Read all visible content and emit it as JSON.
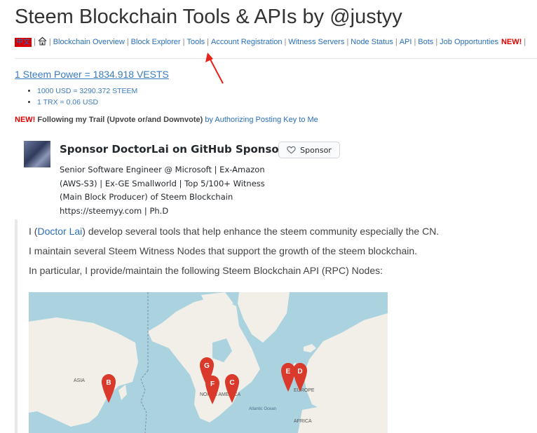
{
  "page": {
    "title": "Steem Blockchain Tools & APIs by @justyy"
  },
  "nav": {
    "lang_badge": "中文",
    "items": [
      "Blockchain Overview",
      "Block Explorer",
      "Tools",
      "Account Registration",
      "Witness Servers",
      "Node Status",
      "API",
      "Bots",
      "Job Opportunties"
    ],
    "new_label": "NEW!"
  },
  "rates": {
    "steem_power": "1 Steem Power = 1834.918 VESTS",
    "usd": "1000 USD = 3290.372 STEEM",
    "trx": "1 TRX = 0.06 USD"
  },
  "trail": {
    "new_label": "NEW!",
    "text": "Following my Trail (Upvote or/and Downvote)",
    "link": "by Authorizing Posting Key to Me"
  },
  "sponsor": {
    "title": "Sponsor DoctorLai on GitHub Sponsors",
    "button": "Sponsor",
    "bio": "Senior Software Engineer @ Microsoft | Ex-Amazon (AWS-S3) | Ex-GE Smallworld | Top 5/100+ Witness (Main Block Producer) of Steem Blockchain https://steemyy.com | Ph.D"
  },
  "content": {
    "p1_pre": "I (",
    "p1_link": "Doctor Lai",
    "p1_post": ") develop several tools that help enhance the steem community especially the CN.",
    "p2": "I maintain several Steem Witness Nodes that support the growth of the steem blockchain.",
    "p3": "In particular, I provide/maintain the following Steem Blockchain API (RPC) Nodes:"
  },
  "map": {
    "labels": {
      "asia": "ASIA",
      "north_america": "NORTH AMERICA",
      "europe": "EUROPE",
      "africa": "AFRICA",
      "atlantic": "Atlantic Ocean"
    },
    "markers": [
      "B",
      "G",
      "F",
      "C",
      "E",
      "D"
    ]
  },
  "colors": {
    "link": "#2a6fb8",
    "new": "#e00000",
    "water": "#aad3df",
    "land": "#f2efe9",
    "marker": "#d93a2b"
  }
}
